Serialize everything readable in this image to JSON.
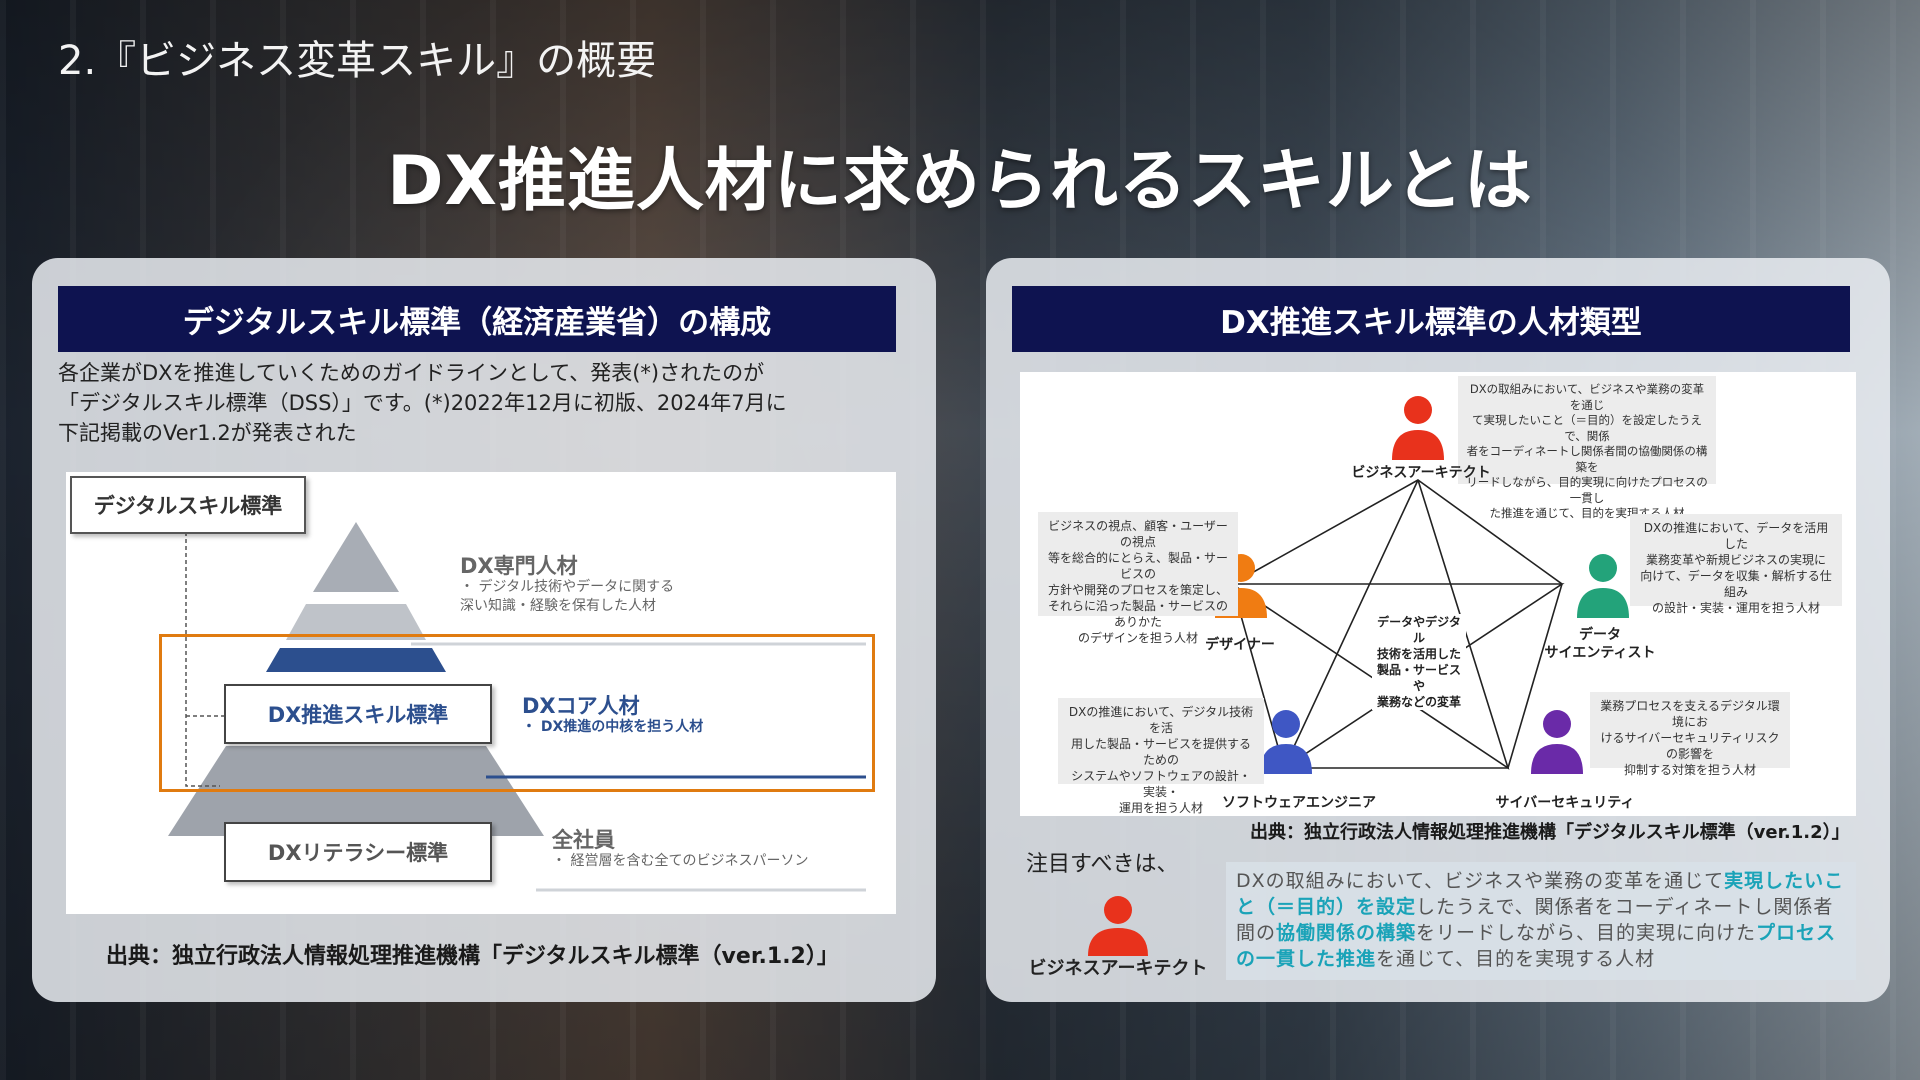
{
  "slide": {
    "section_label": "2.『ビジネス変革スキル』の概要",
    "main_title": "DX推進人材に求められるスキルとは"
  },
  "left": {
    "header": "デジタルスキル標準（経済産業省）の構成",
    "intro": [
      "各企業がDXを推進していくためのガイドラインとして、発表(*)されたのが",
      "「デジタルスキル標準（DSS）」です。(*)2022年12月に初版、2024年7月に",
      "下記掲載のVer1.2が発表された"
    ],
    "figure": {
      "dss_label": "デジタルスキル標準",
      "expert_title": "DX専門人材",
      "expert_desc": [
        "・ デジタル技術やデータに関する",
        "   深い知識・経験を保有した人材"
      ],
      "core_title": "DXコア人材",
      "core_desc": "・ DX推進の中核を担う人材",
      "promotion_std": "DX推進スキル標準",
      "all_title": "全社員",
      "all_desc": "・ 経営層を含む全てのビジネスパーソン",
      "literacy_std": "DXリテラシー標準"
    },
    "source": "出典：独立行政法人情報処理推進機構「デジタルスキル標準（ver.1.2）」"
  },
  "right": {
    "header": "DX推進スキル標準の人材類型",
    "center_label": [
      "データやデジタル",
      "技術を活用した",
      "製品・サービスや",
      "業務などの変革"
    ],
    "roles": [
      {
        "name": "ビジネスアーキテクト",
        "desc": [
          "DXの取組みにおいて、ビジネスや業務の変革を通じ",
          "て実現したいこと（＝目的）を設定したうえで、関係",
          "者をコーディネートし関係者間の協働関係の構築を",
          "リードしながら、目的実現に向けたプロセスの一貫し",
          "た推進を通じて、目的を実現する人材"
        ],
        "color": "#e8321c"
      },
      {
        "name": "データ\nサイエンティスト",
        "desc": [
          "DXの推進において、データを活用した",
          "業務変革や新規ビジネスの実現に",
          "向けて、データを収集・解析する仕組み",
          "の設計・実装・運用を担う人材"
        ],
        "color": "#23a37a"
      },
      {
        "name": "サイバーセキュリティ",
        "desc": [
          "業務プロセスを支えるデジタル環境にお",
          "けるサイバーセキュリティリスクの影響を",
          "抑制する対策を担う人材"
        ],
        "color": "#6a2aa8"
      },
      {
        "name": "ソフトウェアエンジニア",
        "desc": [
          "DXの推進において、デジタル技術を活",
          "用した製品・サービスを提供するための",
          "システムやソフトウェアの設計・実装・",
          "運用を担う人材"
        ],
        "color": "#3f57c4"
      },
      {
        "name": "デザイナー",
        "desc": [
          "ビジネスの視点、顧客・ユーザーの視点",
          "等を総合的にとらえ、製品・サービスの",
          "方針や開発のプロセスを策定し、",
          "それらに沿った製品・サービスのありかた",
          "のデザインを担う人材"
        ],
        "color": "#f07c12"
      }
    ],
    "source": "出典：独立行政法人情報処理推進機構「デジタルスキル標準（ver.1.2）」",
    "note_label": "注目すべきは、",
    "highlight_role": "ビジネスアーキテクト",
    "highlight": {
      "p1": "DXの取組みにおいて、ビジネスや業務の変革を通じて",
      "h1": "実現したいこと（＝目的）を設定",
      "p2": "したうえで、関係者をコーディネートし関係者間の",
      "h2": "協働関係の構築",
      "p3": "をリードしながら、目的実現に向けた",
      "h3": "プロセスの一貫した推進",
      "p4": "を通じて、目的を実現する人材"
    },
    "colors": {
      "accent_teal": "#1aa3b8",
      "header_navy": "#0e1350"
    }
  }
}
